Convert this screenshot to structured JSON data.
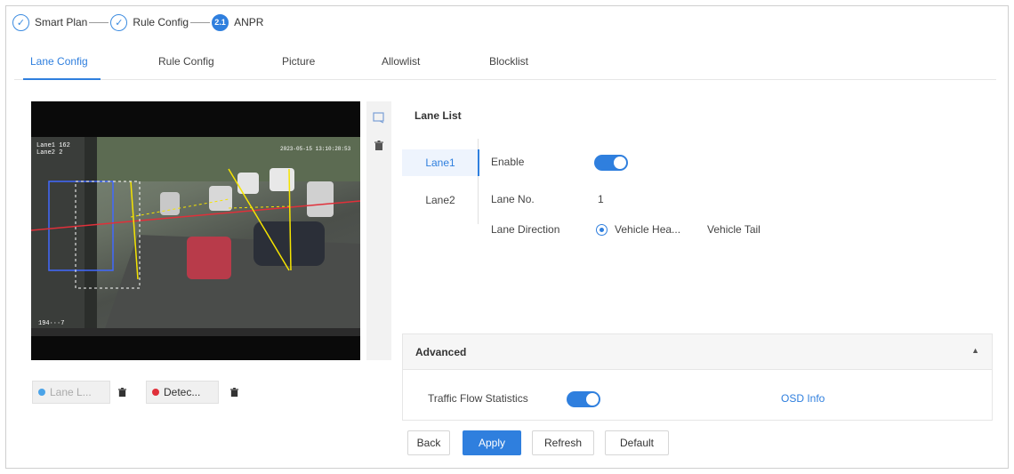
{
  "steps": [
    {
      "label": "Smart Plan",
      "icon": "check-circle-icon"
    },
    {
      "label": "Rule Config",
      "icon": "check-circle-icon"
    },
    {
      "number": "2.1",
      "label": "ANPR"
    }
  ],
  "tabs": [
    "Lane Config",
    "Rule Config",
    "Picture",
    "Allowlist",
    "Blocklist"
  ],
  "active_tab": "Lane Config",
  "video": {
    "overlay_top_left": "Lane1 162\nLane2 2",
    "overlay_timestamp": "2023-05-15 13:10:28:53",
    "overlay_bottom_left": "194···7"
  },
  "side_tools": [
    "draw-area-icon",
    "delete-icon"
  ],
  "rules": [
    {
      "label": "Lane L...",
      "color": "#4aa3e8"
    },
    {
      "label": "Detec...",
      "color": "#e0303a"
    }
  ],
  "lane_list": {
    "title": "Lane List",
    "lanes": [
      "Lane1",
      "Lane2"
    ],
    "selected": "Lane1",
    "enable_label": "Enable",
    "enable_on": true,
    "lane_no_label": "Lane No.",
    "lane_no_value": "1",
    "direction_label": "Lane Direction",
    "direction_options": [
      "Vehicle Hea...",
      "Vehicle Tail"
    ],
    "direction_selected": "Vehicle Hea..."
  },
  "advanced": {
    "title": "Advanced",
    "traffic_flow_label": "Traffic Flow Statistics",
    "traffic_flow_on": true,
    "osd_link": "OSD Info"
  },
  "buttons": {
    "back": "Back",
    "apply": "Apply",
    "refresh": "Refresh",
    "default": "Default"
  },
  "colors": {
    "accent": "#2f7fde"
  }
}
